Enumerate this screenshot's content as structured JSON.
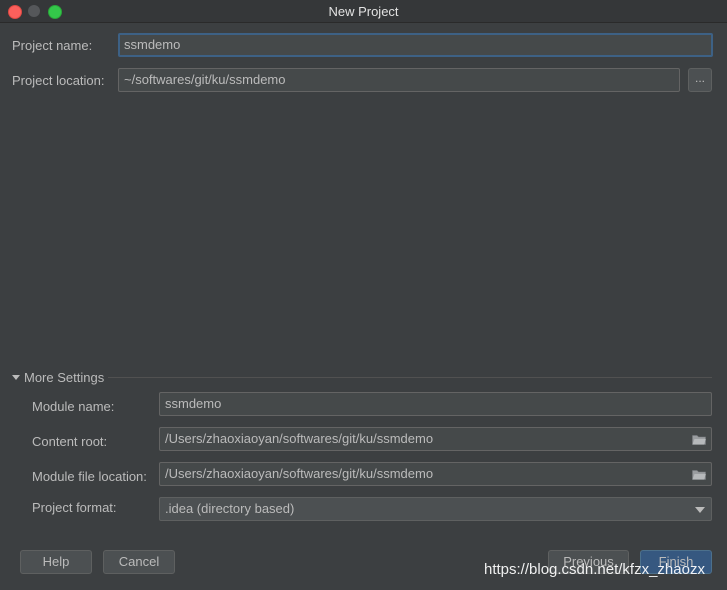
{
  "window": {
    "title": "New Project"
  },
  "project": {
    "name_label": "Project name:",
    "name_value": "ssmdemo",
    "location_label": "Project location:",
    "location_value": "~/softwares/git/ku/ssmdemo",
    "browse_label": "..."
  },
  "more_settings": {
    "header": "More Settings",
    "module_name_label": "Module name:",
    "module_name_value": "ssmdemo",
    "content_root_label": "Content root:",
    "content_root_value": "/Users/zhaoxiaoyan/softwares/git/ku/ssmdemo",
    "module_file_label": "Module file location:",
    "module_file_value": "/Users/zhaoxiaoyan/softwares/git/ku/ssmdemo",
    "format_label": "Project format:",
    "format_value": ".idea (directory based)"
  },
  "buttons": {
    "help": "Help",
    "cancel": "Cancel",
    "previous": "Previous",
    "finish": "Finish"
  },
  "watermark": "https://blog.csdn.net/kfzx_zhaozx"
}
